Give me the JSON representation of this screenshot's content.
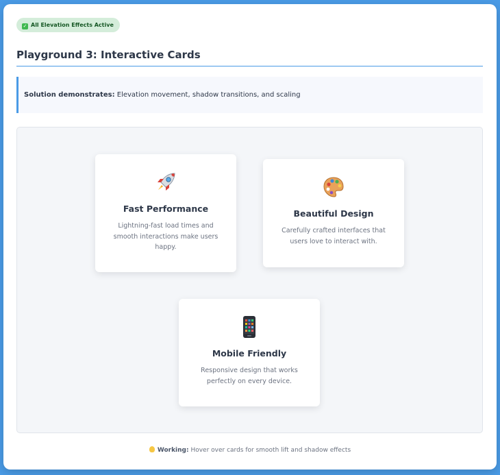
{
  "badge": {
    "text": "All Elevation Effects Active",
    "icon": "check-icon"
  },
  "page_title": "Playground 3: Interactive Cards",
  "callout": {
    "label": "Solution demonstrates:",
    "text": " Elevation movement, shadow transitions, and scaling"
  },
  "cards": [
    {
      "icon": "rocket-icon",
      "title": "Fast Performance",
      "text": "Lightning-fast load times and smooth interactions make users happy."
    },
    {
      "icon": "palette-icon",
      "title": "Beautiful Design",
      "text": "Carefully crafted interfaces that users love to interact with."
    },
    {
      "icon": "mobile-phone-icon",
      "title": "Mobile Friendly",
      "text": "Responsive design that works perfectly on every device."
    }
  ],
  "footer": {
    "icon": "lightbulb-icon",
    "label": "Working:",
    "text": " Hover over cards for smooth lift and shadow effects"
  },
  "colors": {
    "accent": "#4a9be6",
    "badge_bg": "#d4edda",
    "badge_text": "#155724",
    "heading": "#2d3748",
    "muted": "#6b7280"
  }
}
